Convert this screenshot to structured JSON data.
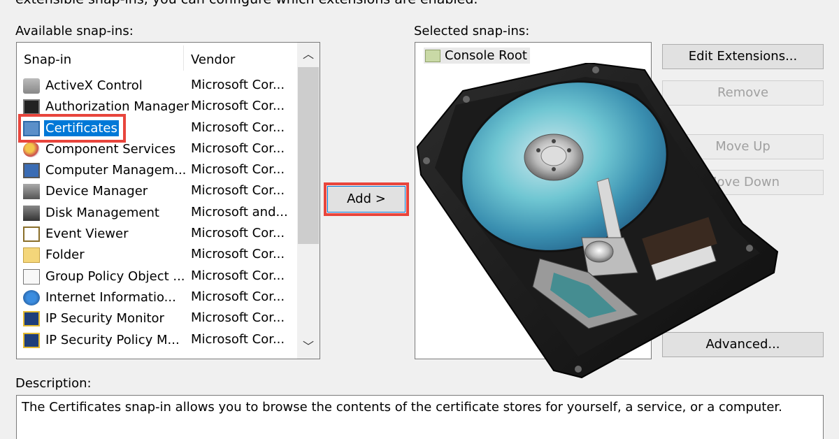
{
  "header_text": "extensible snap-ins, you can configure which extensions are enabled.",
  "available": {
    "label": "Available snap-ins:",
    "columns": [
      "Snap-in",
      "Vendor"
    ],
    "items": [
      {
        "name": "ActiveX Control",
        "vendor": "Microsoft Cor...",
        "icon": "activex-icon"
      },
      {
        "name": "Authorization Manager",
        "vendor": "Microsoft Cor...",
        "icon": "authorization-manager-icon"
      },
      {
        "name": "Certificates",
        "vendor": "Microsoft Cor...",
        "icon": "certificates-icon",
        "selected": true
      },
      {
        "name": "Component Services",
        "vendor": "Microsoft Cor...",
        "icon": "component-services-icon"
      },
      {
        "name": "Computer Managem...",
        "vendor": "Microsoft Cor...",
        "icon": "computer-management-icon"
      },
      {
        "name": "Device Manager",
        "vendor": "Microsoft Cor...",
        "icon": "device-manager-icon"
      },
      {
        "name": "Disk Management",
        "vendor": "Microsoft and...",
        "icon": "disk-management-icon"
      },
      {
        "name": "Event Viewer",
        "vendor": "Microsoft Cor...",
        "icon": "event-viewer-icon"
      },
      {
        "name": "Folder",
        "vendor": "Microsoft Cor...",
        "icon": "folder-icon"
      },
      {
        "name": "Group Policy Object ...",
        "vendor": "Microsoft Cor...",
        "icon": "group-policy-icon"
      },
      {
        "name": "Internet Informatio...",
        "vendor": "Microsoft Cor...",
        "icon": "iis-icon"
      },
      {
        "name": "IP Security Monitor",
        "vendor": "Microsoft Cor...",
        "icon": "ip-security-monitor-icon"
      },
      {
        "name": "IP Security Policy M...",
        "vendor": "Microsoft Cor...",
        "icon": "ip-security-policy-icon"
      }
    ]
  },
  "add_button": "Add >",
  "selected": {
    "label": "Selected snap-ins:",
    "items": [
      "Console Root"
    ]
  },
  "buttons": {
    "edit_extensions": "Edit Extensions...",
    "remove": "Remove",
    "move_up": "Move Up",
    "move_down": "Move Down",
    "advanced": "Advanced..."
  },
  "description": {
    "label": "Description:",
    "text": "The Certificates snap-in allows you to browse the contents of the certificate stores for yourself, a service, or a computer."
  },
  "colors": {
    "highlight_red": "#e8453c",
    "selection_blue": "#0078d7"
  }
}
